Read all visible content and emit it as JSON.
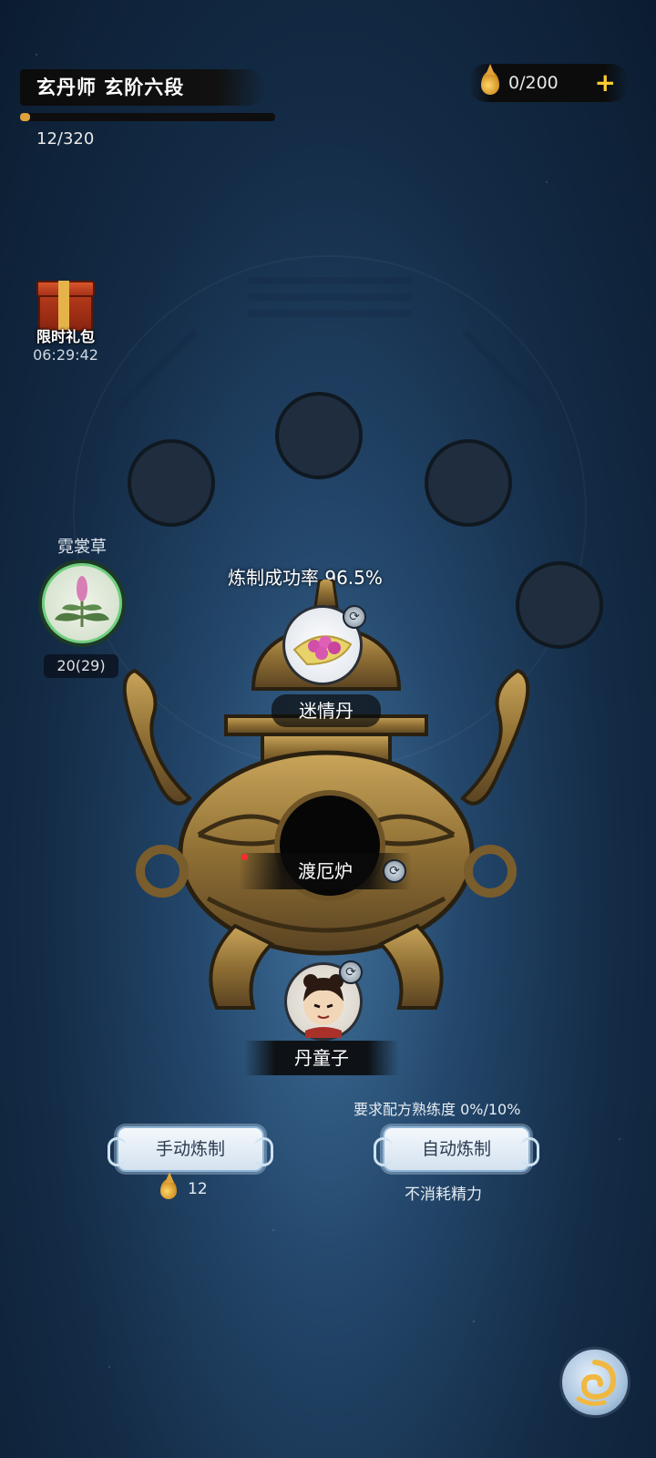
{
  "header": {
    "rank_title": "玄丹师 玄阶六段",
    "xp_text": "12/320",
    "xp_progress": 0.0375,
    "currency_value": "0/200",
    "currency_icon": "elixir-drop-icon",
    "add_icon": "plus-icon"
  },
  "gift": {
    "label": "限时礼包",
    "timer": "06:29:42",
    "icon": "gift-box-icon"
  },
  "herb": {
    "name": "霓裳草",
    "count": "20(29)",
    "icon": "herb-plant-icon"
  },
  "refining": {
    "success_rate": "炼制成功率 96.5%",
    "pill_name": "迷情丹",
    "pill_icon": "pink-pill-icon",
    "furnace_name": "渡厄炉",
    "assistant_name": "丹童子",
    "assistant_icon": "alchemy-boy-avatar",
    "swap_icon": "swap-icon"
  },
  "actions": {
    "requirement_text": "要求配方熟练度 0%/10%",
    "manual_button": "手动炼制",
    "auto_button": "自动炼制",
    "manual_cost": "12",
    "auto_note": "不消耗精力"
  },
  "colors": {
    "accent_gold": "#e0a23a",
    "plus_yellow": "#ffcc33",
    "herb_ring": "#6ecf7e",
    "notification_red": "#ff2a2a"
  }
}
